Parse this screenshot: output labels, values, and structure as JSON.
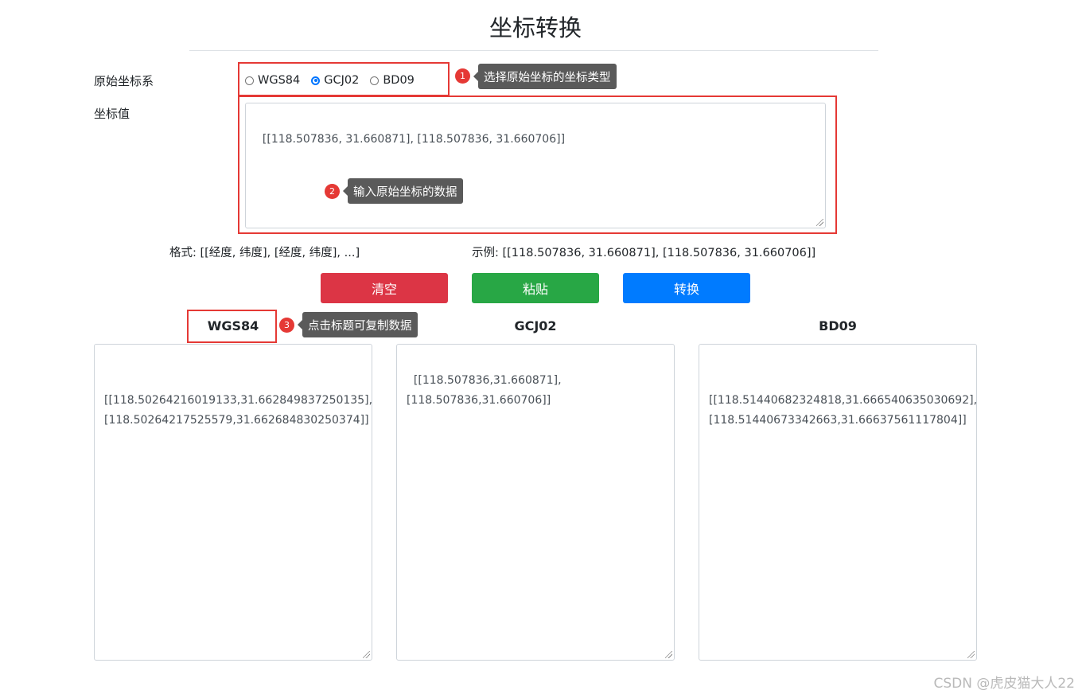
{
  "title": "坐标转换",
  "source": {
    "label": "原始坐标系",
    "options": [
      "WGS84",
      "GCJ02",
      "BD09"
    ],
    "selected": "GCJ02"
  },
  "input": {
    "label": "坐标值",
    "value": "[[118.507836, 31.660871], [118.507836, 31.660706]]"
  },
  "format_hint": "格式: [[经度, 纬度], [经度, 纬度], ...]",
  "example_hint": "示例: [[118.507836, 31.660871], [118.507836, 31.660706]]",
  "buttons": {
    "clear": "清空",
    "paste": "粘贴",
    "convert": "转换"
  },
  "results": [
    {
      "title": "WGS84",
      "value": "[[118.50264216019133,31.662849837250135],\n[118.50264217525579,31.662684830250374]]"
    },
    {
      "title": "GCJ02",
      "value": "[[118.507836,31.660871],\n[118.507836,31.660706]]"
    },
    {
      "title": "BD09",
      "value": "[[118.51440682324818,31.666540635030692],\n[118.51440673342663,31.66637561117804]]"
    }
  ],
  "annotations": [
    {
      "num": "1",
      "text": "选择原始坐标的坐标类型"
    },
    {
      "num": "2",
      "text": "输入原始坐标的数据"
    },
    {
      "num": "3",
      "text": "点击标题可复制数据"
    }
  ],
  "watermark": "CSDN @虎皮猫大人22",
  "colors": {
    "clear_button": "#dc3545",
    "paste_button": "#28a745",
    "convert_button": "#007bff",
    "annotation_box": "#e53935",
    "tooltip_bg": "#5a5a5a"
  }
}
